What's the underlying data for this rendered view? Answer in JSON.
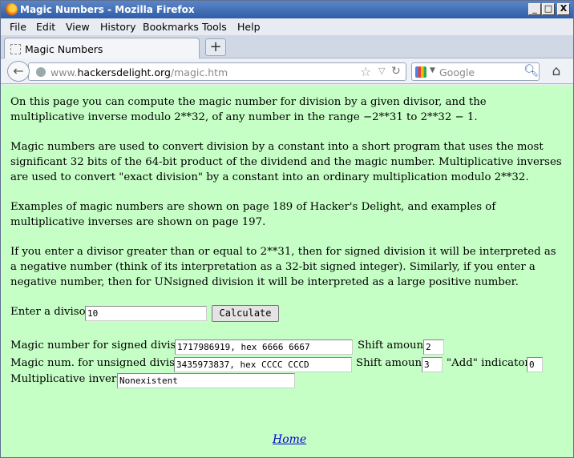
{
  "window": {
    "title": "Magic Numbers - Mozilla Firefox",
    "controls": {
      "minimize": "_",
      "maximize": "□",
      "close": "X"
    }
  },
  "menu": [
    "File",
    "Edit",
    "View",
    "History",
    "Bookmarks",
    "Tools",
    "Help"
  ],
  "tab": {
    "label": "Magic Numbers",
    "new_tab": "+"
  },
  "navbar": {
    "url_prefix": "www.",
    "url_host": "hackersdelight.org",
    "url_path": "/magic.htm",
    "search_placeholder": "Google"
  },
  "page": {
    "paragraphs": [
      "On this page you can compute the magic number for division by a given divisor, and the multiplicative inverse modulo 2**32, of any number in the range −2**31 to 2**32 − 1.",
      "Magic numbers are used to convert division by a constant into a short program that uses the most significant 32 bits of the 64-bit product of the dividend and the magic number. Multiplicative inverses are used to convert \"exact division\" by a constant into an ordinary multiplication modulo 2**32.",
      "Examples of magic numbers are shown on page 189 of Hacker's Delight, and examples of multiplicative inverses are shown on page 197.",
      "If you enter a divisor greater than or equal to 2**31, then for signed division it will be interpreted as a negative number (think of its interpretation as a 32-bit signed integer). Similarly, if you enter a negative number, then for UNsigned division it will be interpreted as a large positive number."
    ],
    "divisor_label": "Enter a divisor:",
    "divisor_value": "10",
    "calculate_label": "Calculate",
    "signed_label": "Magic number for signed division:",
    "signed_value": "1717986919, hex 6666 6667",
    "signed_shift_label": "Shift amount:",
    "signed_shift_value": "2",
    "unsigned_label": "Magic num. for unsigned division:",
    "unsigned_value": "3435973837, hex CCCC CCCD",
    "unsigned_shift_label": "Shift amount:",
    "unsigned_shift_value": "3",
    "add_label": "\"Add\" indicator:",
    "add_value": "0",
    "inverse_label": "Multiplicative inverse:",
    "inverse_value": "Nonexistent",
    "home_link": "Home"
  }
}
